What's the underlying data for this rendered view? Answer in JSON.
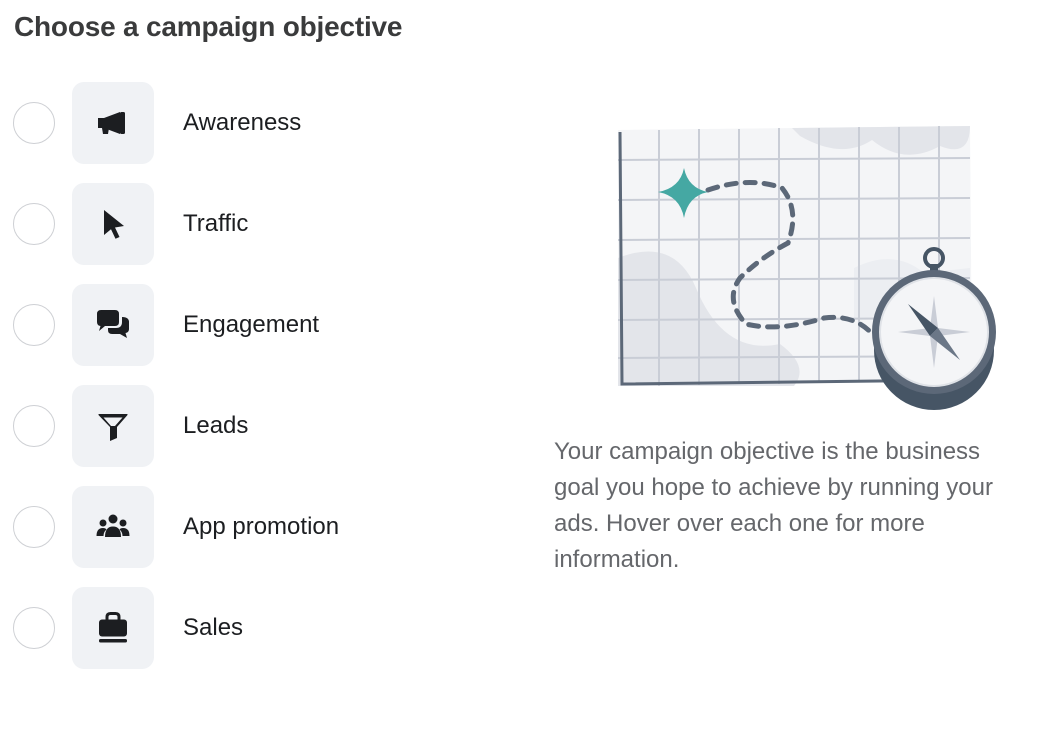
{
  "page": {
    "heading": "Choose a campaign objective",
    "description": "Your campaign objective is the business goal you hope to achieve by running your ads. Hover over each one for more information."
  },
  "objectives": [
    {
      "label": "Awareness",
      "icon": "megaphone-icon",
      "selected": false
    },
    {
      "label": "Traffic",
      "icon": "cursor-icon",
      "selected": false
    },
    {
      "label": "Engagement",
      "icon": "chat-bubbles-icon",
      "selected": false
    },
    {
      "label": "Leads",
      "icon": "funnel-icon",
      "selected": false
    },
    {
      "label": "App promotion",
      "icon": "people-group-icon",
      "selected": false
    },
    {
      "label": "Sales",
      "icon": "shopping-bag-icon",
      "selected": false
    }
  ],
  "colors": {
    "icon": "#1c1e21",
    "icon_tile": "#f0f2f5",
    "radio_border": "#ced0d4",
    "accent_teal": "#45a8a3",
    "compass_dark": "#465565",
    "map_grid": "#c9cdd6",
    "map_fill": "#eceef2",
    "description_text": "#65676b"
  },
  "illustration": {
    "icon": "treasure-map-compass-icon"
  }
}
